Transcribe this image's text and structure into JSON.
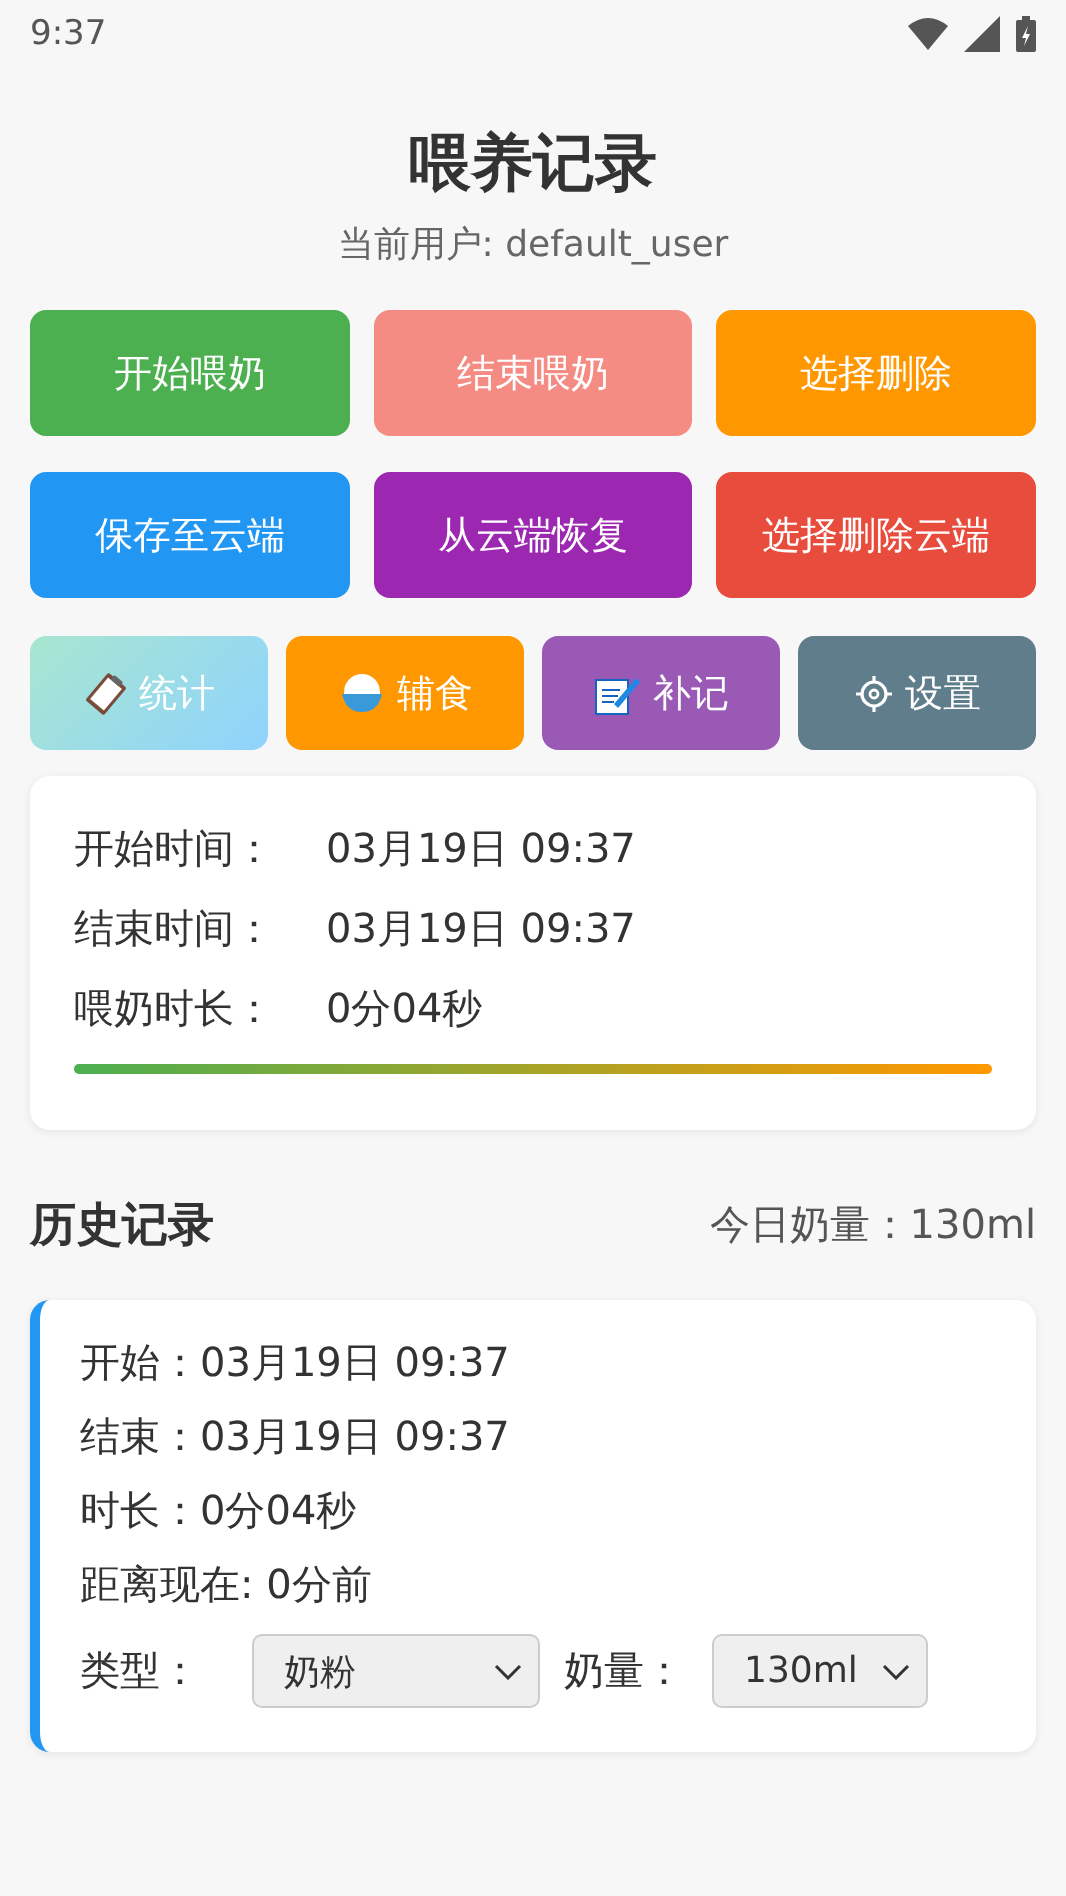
{
  "status_bar": {
    "time": "9:37"
  },
  "title": "喂养记录",
  "user": "当前用户: default_user",
  "buttons": [
    {
      "label": "开始喂奶",
      "color": "#4caf50"
    },
    {
      "label": "结束喂奶",
      "color": "#f48c84"
    },
    {
      "label": "选择删除",
      "color": "#ff9800"
    },
    {
      "label": "保存至云端",
      "color": "#2196f3"
    },
    {
      "label": "从云端恢复",
      "color": "#9c27b0"
    },
    {
      "label": "选择删除云端",
      "color": "#e74c3c"
    }
  ],
  "tiles": [
    {
      "label": "统计",
      "kind": "stats",
      "color": "#a8e6cf"
    },
    {
      "label": "辅食",
      "kind": "food",
      "color": "#ff9800"
    },
    {
      "label": "补记",
      "kind": "note",
      "color": "#9b59b6"
    },
    {
      "label": "设置",
      "kind": "settings",
      "color": "#607d8b"
    }
  ],
  "current": {
    "rows": [
      {
        "label": "开始时间：",
        "value": "03月19日 09:37"
      },
      {
        "label": "结束时间：",
        "value": "03月19日 09:37"
      },
      {
        "label": "喂奶时长：",
        "value": "0分04秒"
      }
    ],
    "level": 1
  },
  "history": {
    "title": "历史记录",
    "today": "今日奶量：130ml",
    "records": [
      {
        "lines": [
          "开始：03月19日 09:37",
          "结束：03月19日 09:37",
          "时长：0分04秒",
          "距离现在: 0分前"
        ],
        "type_label": "类型：",
        "type_value": "奶粉",
        "amount_label": "奶量：",
        "amount_value": "130ml"
      }
    ]
  }
}
